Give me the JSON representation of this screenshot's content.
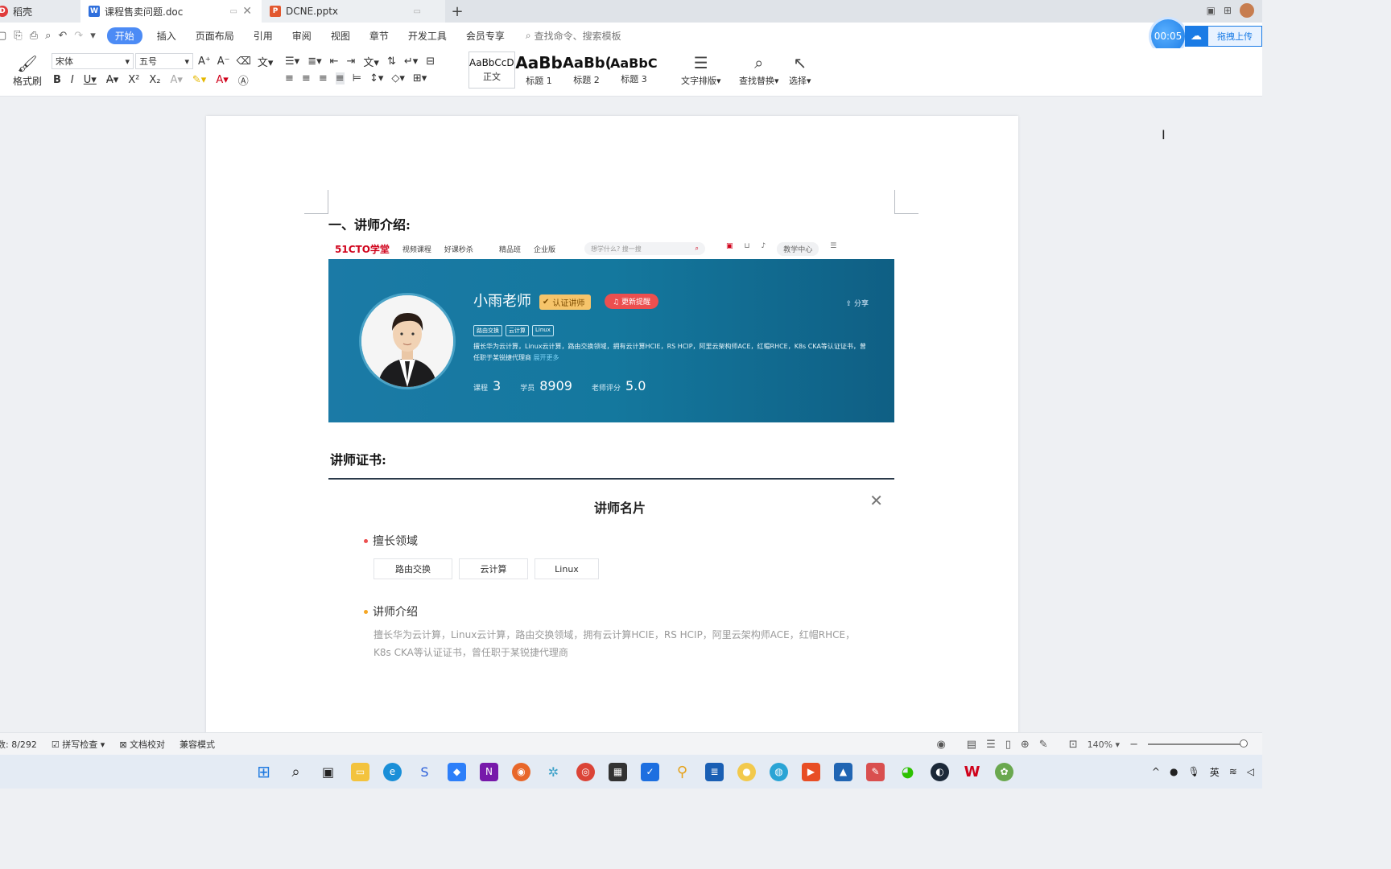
{
  "tabs": [
    {
      "label": "稻壳"
    },
    {
      "label": "课程售卖问题.doc"
    },
    {
      "label": "DCNE.pptx"
    }
  ],
  "menu": {
    "items": [
      "开始",
      "插入",
      "页面布局",
      "引用",
      "审阅",
      "视图",
      "章节",
      "开发工具",
      "会员专享"
    ],
    "search_placeholder": "查找命令、搜索模板"
  },
  "timer": "00:05",
  "upload_label": "拖拽上传",
  "toolbar": {
    "format_brush": "格式刷",
    "font_name": "宋体",
    "font_size": "五号",
    "styles": [
      {
        "preview": "AaBbCcDd",
        "label": "正文"
      },
      {
        "preview": "AaBb",
        "label": "标题 1"
      },
      {
        "preview": "AaBb(",
        "label": "标题 2"
      },
      {
        "preview": "AaBbC(",
        "label": "标题 3"
      }
    ],
    "text_layout": "文字排版",
    "find_replace": "查找替换",
    "select": "选择"
  },
  "document": {
    "heading1": "一、讲师介绍:",
    "heading2": "讲师证书:",
    "profile": {
      "logo": "51CTO学堂",
      "nav": [
        "视频课程",
        "好课秒杀",
        "精品班",
        "企业版"
      ],
      "search_placeholder": "想学什么? 搜一搜",
      "teach_center": "教学中心",
      "name": "小雨老师",
      "cert": "认证讲师",
      "update": "更新提醒",
      "share": "分享",
      "tags": [
        "路由交换",
        "云计算",
        "Linux"
      ],
      "desc": "擅长华为云计算，Linux云计算，路由交换领域，拥有云计算HCIE，RS HCIP，阿里云架构师ACE，红帽RHCE，K8s CKA等认证证书，曾任职于某锐捷代理商",
      "more": "展开更多",
      "stats": [
        {
          "label": "课程",
          "value": "3"
        },
        {
          "label": "学员",
          "value": "8909"
        },
        {
          "label": "老师评分",
          "value": "5.0"
        }
      ]
    },
    "card": {
      "title": "讲师名片",
      "expertise_label": "擅长领域",
      "chips": [
        "路由交换",
        "云计算",
        "Linux"
      ],
      "intro_label": "讲师介绍",
      "intro": "擅长华为云计算，Linux云计算，路由交换领域，拥有云计算HCIE，RS HCIP，阿里云架构师ACE，红帽RHCE，K8s CKA等认证证书，曾任职于某锐捷代理商"
    }
  },
  "status": {
    "pages": "数: 8/292",
    "spell": "拼写检查",
    "proof": "文档校对",
    "compat": "兼容模式",
    "zoom": "140%"
  },
  "tray": {
    "ime": "英"
  },
  "colors": {
    "accent": "#4c8bf5",
    "banner": "#14789e",
    "red_dot": "#ec4f4f",
    "orange_dot": "#f5a623"
  }
}
